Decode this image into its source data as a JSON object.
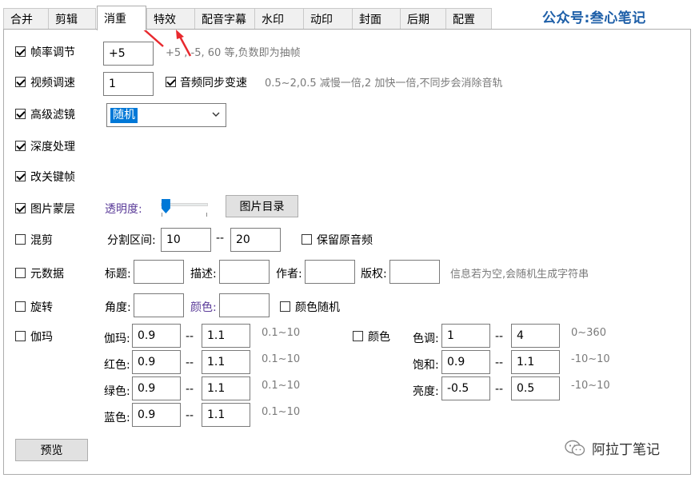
{
  "tabs": [
    "合并",
    "剪辑",
    "消重",
    "特效",
    "配音字幕",
    "水印",
    "动印",
    "封面",
    "后期",
    "配置"
  ],
  "active_tab": 2,
  "watermark_top": "公众号:叁心笔记",
  "watermark_bottom": "阿拉丁笔记",
  "frame_rate": {
    "label": "帧率调节",
    "checked": true,
    "value": "+5",
    "hint": "+5 , -5, 60 等,负数即为抽帧"
  },
  "video_speed": {
    "label": "视频调速",
    "checked": true,
    "value": "1",
    "audio_sync_label": "音频同步变速",
    "audio_sync_checked": true,
    "hint": "0.5~2,0.5 减慢一倍,2 加快一倍,不同步会消除音轨"
  },
  "filter": {
    "label": "高级滤镜",
    "checked": true,
    "selected": "随机"
  },
  "depth": {
    "label": "深度处理",
    "checked": true
  },
  "keyframe": {
    "label": "改关键帧",
    "checked": true
  },
  "overlay": {
    "label": "图片蒙层",
    "checked": true,
    "opacity_label": "透明度:",
    "opacity_value": 0.1,
    "dir_button": "图片目录"
  },
  "mix": {
    "label": "混剪",
    "checked": false,
    "range_label": "分割区间:",
    "from": "10",
    "sep": "--",
    "to": "20",
    "keep_audio_label": "保留原音频",
    "keep_audio_checked": false
  },
  "metadata": {
    "label": "元数据",
    "checked": false,
    "title_label": "标题:",
    "desc_label": "描述:",
    "author_label": "作者:",
    "copyright_label": "版权:",
    "hint": "信息若为空,会随机生成字符串"
  },
  "rotate": {
    "label": "旋转",
    "checked": false,
    "angle_label": "角度:",
    "color_label": "颜色:",
    "random_color_label": "颜色随机",
    "random_color_checked": false
  },
  "gamma": {
    "label": "伽玛",
    "checked": false,
    "rows": [
      {
        "label": "伽玛:",
        "from": "0.9",
        "to": "1.1",
        "range": "0.1~10"
      },
      {
        "label": "红色:",
        "from": "0.9",
        "to": "1.1",
        "range": "0.1~10"
      },
      {
        "label": "绿色:",
        "from": "0.9",
        "to": "1.1",
        "range": "0.1~10"
      },
      {
        "label": "蓝色:",
        "from": "0.9",
        "to": "1.1",
        "range": "0.1~10"
      }
    ],
    "sep": "--"
  },
  "color": {
    "label": "颜色",
    "checked": false,
    "rows": [
      {
        "label": "色调:",
        "from": "1",
        "to": "4",
        "range": "0~360"
      },
      {
        "label": "饱和:",
        "from": "0.9",
        "to": "1.1",
        "range": "-10~10"
      },
      {
        "label": "亮度:",
        "from": "-0.5",
        "to": "0.5",
        "range": "-10~10"
      }
    ]
  },
  "preview_button": "预览",
  "colors": {
    "accent": "#0078d7",
    "annotation_arrow": "#e8292e",
    "watermark": "#1e5fa8"
  }
}
